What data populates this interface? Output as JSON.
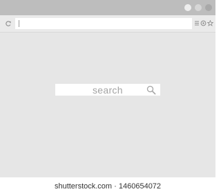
{
  "search": {
    "placeholder": "search"
  },
  "watermark": {
    "text": "shutterstock.com · 1460654072"
  },
  "colors": {
    "titlebar": "#bdbdbd",
    "toolbar": "#eaeaea",
    "viewport": "#e6e6e6",
    "search_text": "#a3a3a3"
  },
  "icons": [
    "reload-icon",
    "menu-icon",
    "extension-icon",
    "star-icon",
    "search-icon"
  ]
}
